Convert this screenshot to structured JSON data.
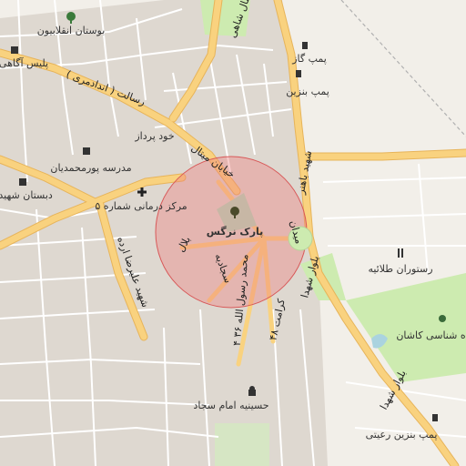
{
  "map": {
    "colors": {
      "background": "#f2efe9",
      "block": "#ded8d0",
      "green": "#cdebb0",
      "primary_road": "#f9d27f",
      "primary_casing": "#e7b45a",
      "minor_road": "#ffffff",
      "rail": "#b0b0b0",
      "highlight_fill": "#f07c7c",
      "highlight_stroke": "#d85858",
      "water": "#aad3df"
    },
    "pois": [
      {
        "name": "بوستان انقلابیون",
        "icon": "park-tree-icon"
      },
      {
        "name": "پلیس آگاهی",
        "icon": "police-icon"
      },
      {
        "name": "پمپ گاز",
        "icon": "fuel-icon"
      },
      {
        "name": "پمپ بنزین",
        "icon": "fuel-icon"
      },
      {
        "name": "خود پرداز",
        "icon": "atm-icon"
      },
      {
        "name": "مدرسه پورمحمدیان",
        "icon": "school-icon"
      },
      {
        "name": "دبستان شهید صا",
        "icon": "school-icon"
      },
      {
        "name": "مرکز درمانی شماره ۵",
        "icon": "medical-cross-icon"
      },
      {
        "name": "پارک نرگس",
        "icon": "park-tree-icon"
      },
      {
        "name": "رستوران طلائیه",
        "icon": "restaurant-icon"
      },
      {
        "name": "اه شناسی کاشان",
        "icon": "landmark-icon"
      },
      {
        "name": "حسینیه امام سجاد",
        "icon": "mosque-icon"
      },
      {
        "name": "پمپ بنزین رعیتی",
        "icon": "fuel-icon"
      }
    ],
    "streets": {
      "resalat": "رسالت ( اندادمری )",
      "meydan_mital": "خیابان میتال",
      "sh_shahabadi": "شمال شاهی",
      "bahonar": "شهید باهنر",
      "meydan_arg": "میدان",
      "bolvar_shohada": "بلوار شهدا",
      "bolvar_shohada_2": "بلوار شهدا",
      "alireza_arde": "شهید علیرضا ارده",
      "hejab": "بلال",
      "sajjadieh": "سجادیه",
      "mohammad_rasoul": "محمد رسول الله ۳۶ ۴",
      "keramat": "کرامت ۴۸"
    }
  }
}
